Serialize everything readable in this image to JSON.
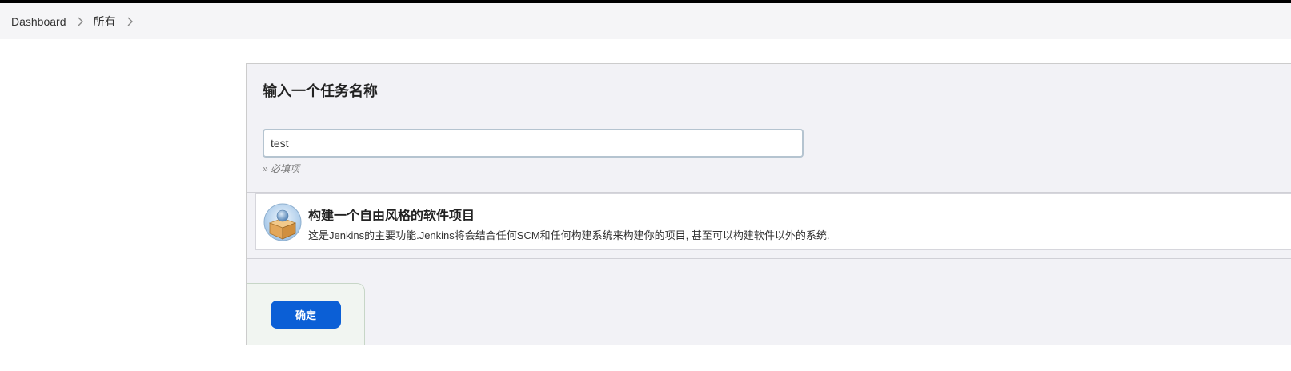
{
  "breadcrumb": {
    "items": [
      {
        "label": "Dashboard"
      },
      {
        "label": "所有"
      }
    ]
  },
  "form": {
    "title": "输入一个任务名称",
    "name_value": "test",
    "required_hint": "» 必填项"
  },
  "item_types": [
    {
      "title": "构建一个自由风格的软件项目",
      "description": "这是Jenkins的主要功能.Jenkins将会结合任何SCM和任何构建系统来构建你的项目, 甚至可以构建软件以外的系统.",
      "icon": "freestyle-project-icon"
    }
  ],
  "actions": {
    "ok_label": "确定"
  },
  "colors": {
    "accent": "#0b5fd6",
    "panel_bg": "#f2f2f6",
    "breadcrumb_bg": "#f5f5f7"
  }
}
